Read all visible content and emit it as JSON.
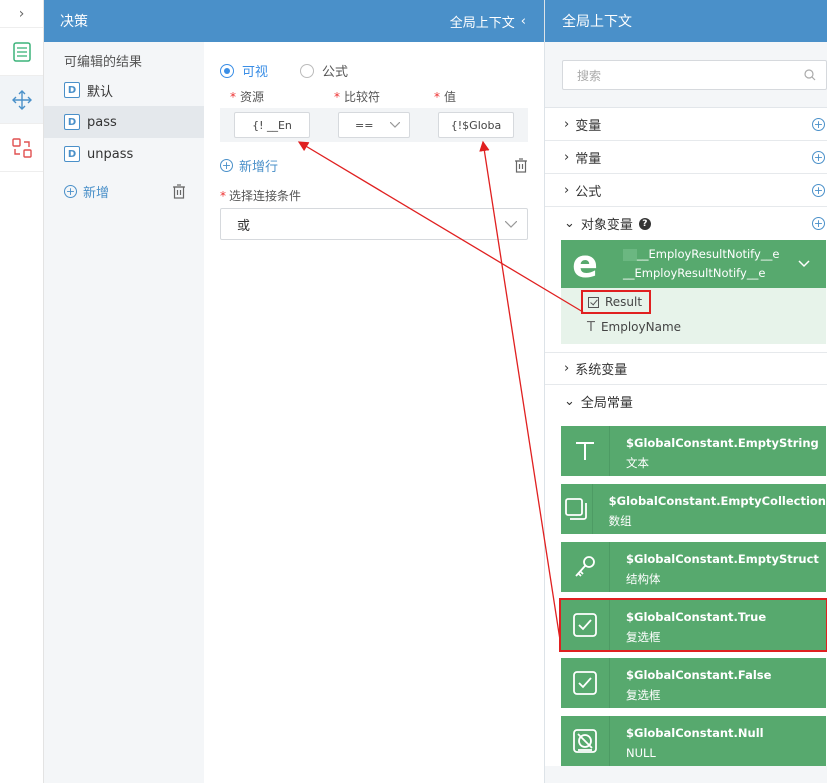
{
  "decision": {
    "title": "决策",
    "global_context_toggle": "全局上下文",
    "results_title": "可编辑的结果",
    "results": [
      {
        "badge": "D",
        "label": "默认"
      },
      {
        "badge": "D",
        "label": "pass"
      },
      {
        "badge": "D",
        "label": "unpass"
      }
    ],
    "add_label": "新增",
    "mode_visual": "可视",
    "mode_formula": "公式",
    "col_resource": "资源",
    "col_compare": "比较符",
    "col_value": "值",
    "cond_resource": "{!  __En",
    "cond_compare": "==",
    "cond_value": "{!$Globa",
    "new_row_label": "新增行",
    "conn_label": "选择连接条件",
    "conn_value": "或"
  },
  "context": {
    "title": "全局上下文",
    "search_placeholder": "搜索",
    "sections": {
      "variables": "变量",
      "constants": "常量",
      "formulas": "公式",
      "object_vars": "对象变量",
      "system_vars": "系统变量",
      "global_consts": "全局常量"
    },
    "object_card": {
      "letter": "e",
      "name1": "__EmployResultNotify__e",
      "name2": "__EmployResultNotify__e",
      "fields": [
        "Result",
        "EmployName"
      ]
    },
    "global_constants": [
      {
        "name": "$GlobalConstant.EmptyString",
        "type": "文本",
        "icon": "text-icon"
      },
      {
        "name": "$GlobalConstant.EmptyCollection",
        "type": "数组",
        "icon": "collection-icon"
      },
      {
        "name": "$GlobalConstant.EmptyStruct",
        "type": "结构体",
        "icon": "key-icon"
      },
      {
        "name": "$GlobalConstant.True",
        "type": "复选框",
        "icon": "checkbox-icon"
      },
      {
        "name": "$GlobalConstant.False",
        "type": "复选框",
        "icon": "checkbox-icon"
      },
      {
        "name": "$GlobalConstant.Null",
        "type": "NULL",
        "icon": "null-icon"
      }
    ]
  },
  "colors": {
    "header": "#4a90c9",
    "card": "#57a96e",
    "highlight": "#e02020"
  }
}
